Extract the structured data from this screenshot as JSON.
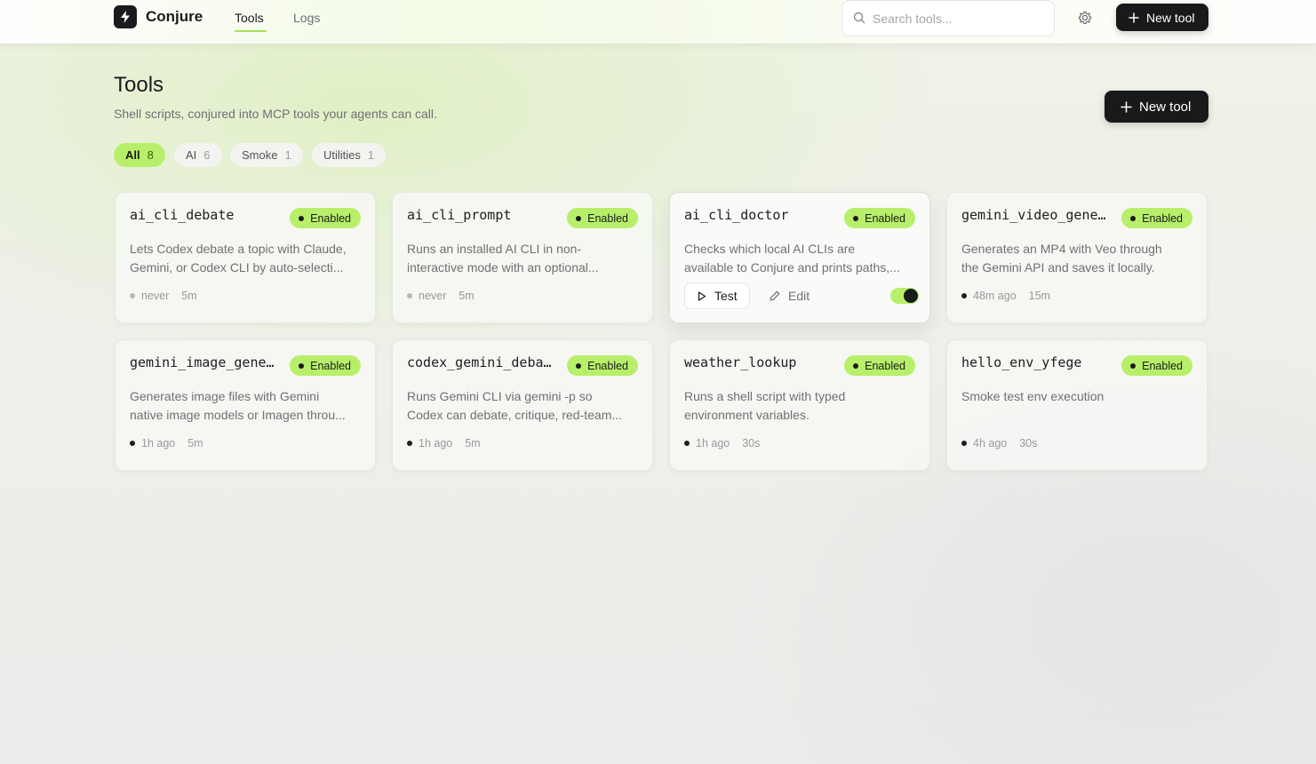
{
  "app": {
    "name": "Conjure",
    "nav": [
      {
        "label": "Tools",
        "active": true
      },
      {
        "label": "Logs",
        "active": false
      }
    ],
    "search_placeholder": "Search tools...",
    "new_tool_label": "New tool",
    "icons": {
      "logo": "bolt-icon",
      "search": "search-icon",
      "settings": "gear-icon",
      "plus": "plus-icon"
    }
  },
  "page": {
    "title": "Tools",
    "subtitle": "Shell scripts, conjured into MCP tools your agents can call.",
    "new_tool_label": "New tool"
  },
  "filters": [
    {
      "label": "All",
      "count": "8",
      "active": true
    },
    {
      "label": "AI",
      "count": "6",
      "active": false
    },
    {
      "label": "Smoke",
      "count": "1",
      "active": false
    },
    {
      "label": "Utilities",
      "count": "1",
      "active": false
    }
  ],
  "colors": {
    "accent": "#b8ef6a",
    "dark": "#18191b",
    "muted_text": "#6e7074"
  },
  "tools": [
    {
      "name": "ai_cli_debate",
      "status": "Enabled",
      "desc": "Lets Codex debate a topic with Claude,\nGemini, or Codex CLI by auto-selecti...",
      "last_run": "never",
      "timeout": "5m",
      "has_run": false
    },
    {
      "name": "ai_cli_prompt",
      "status": "Enabled",
      "desc": "Runs an installed AI CLI in non-\ninteractive mode with an optional...",
      "last_run": "never",
      "timeout": "5m",
      "has_run": false
    },
    {
      "name": "ai_cli_doctor",
      "status": "Enabled",
      "desc": "Checks which local AI CLIs are\navailable to Conjure and prints paths,...",
      "hovered": true,
      "test_label": "Test",
      "edit_label": "Edit",
      "enabled_toggle": true
    },
    {
      "name": "gemini_video_gene…",
      "status": "Enabled",
      "desc": "Generates an MP4 with Veo through\nthe Gemini API and saves it locally.",
      "last_run": "48m ago",
      "timeout": "15m",
      "has_run": true
    },
    {
      "name": "gemini_image_gene…",
      "status": "Enabled",
      "desc": "Generates image files with Gemini\nnative image models or Imagen throu...",
      "last_run": "1h ago",
      "timeout": "5m",
      "has_run": true
    },
    {
      "name": "codex_gemini_deba…",
      "status": "Enabled",
      "desc": "Runs Gemini CLI via gemini -p so\nCodex can debate, critique, red-team...",
      "last_run": "1h ago",
      "timeout": "5m",
      "has_run": true
    },
    {
      "name": "weather_lookup",
      "status": "Enabled",
      "desc": "Runs a shell script with typed\nenvironment variables.",
      "last_run": "1h ago",
      "timeout": "30s",
      "has_run": true
    },
    {
      "name": "hello_env_yfege",
      "status": "Enabled",
      "desc": "Smoke test env execution",
      "last_run": "4h ago",
      "timeout": "30s",
      "has_run": true
    }
  ]
}
